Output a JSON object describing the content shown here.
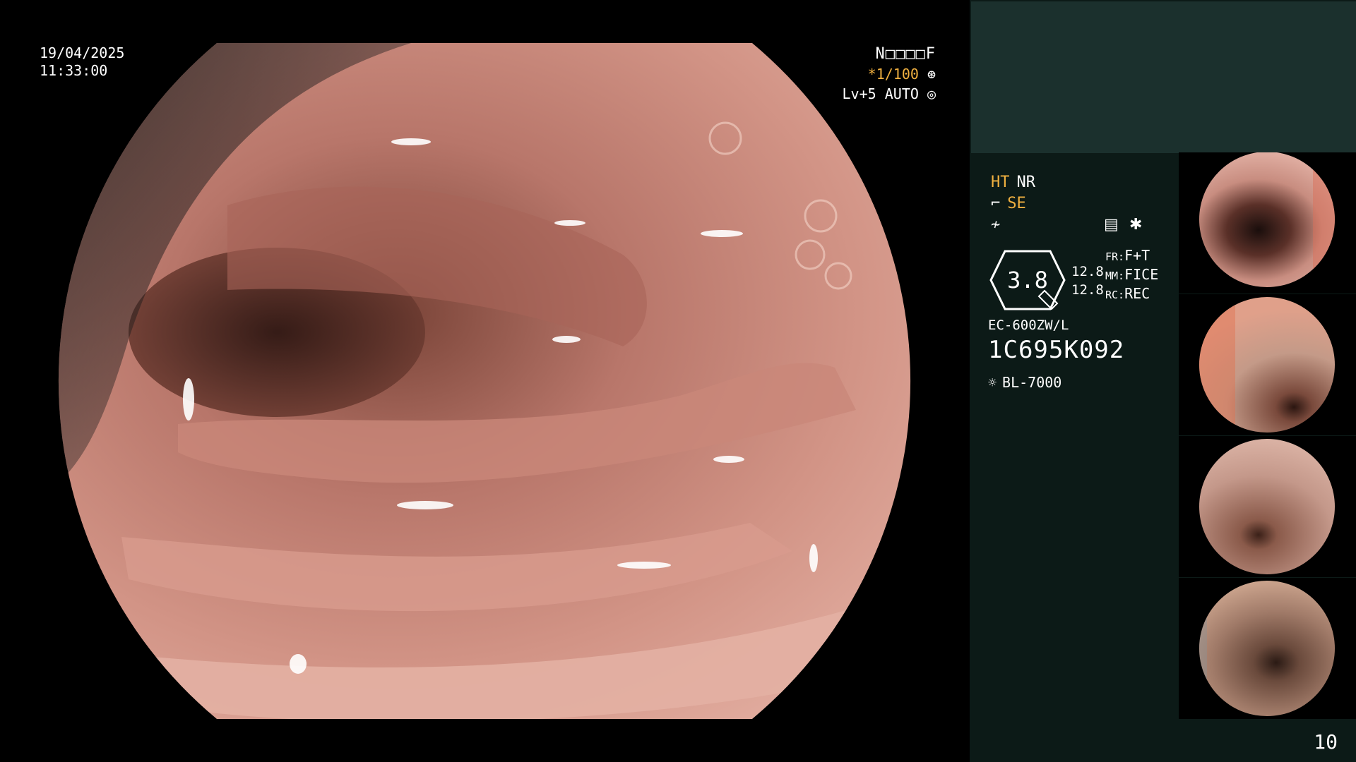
{
  "osd": {
    "date": "19/04/2025",
    "time": "11:33:00",
    "patient_id": "N□□□□F",
    "shutter": "*1/100",
    "level": "Lv+5",
    "iris_mode": "AUTO"
  },
  "panel": {
    "mode_ht": "HT",
    "mode_nr": "NR",
    "mode_se": "SE",
    "gauge_value": "3.8",
    "stat1": "12.8",
    "stat2": "12.8",
    "fr_label": "FR:",
    "fr_value": "F+T",
    "mm_label": "MM:",
    "mm_value": "FICE",
    "rc_label": "RC:",
    "rc_value": "REC",
    "scope_model": "EC-600ZW/L",
    "scope_serial": "1C695K092",
    "light_source": "BL-7000"
  },
  "page_number": "10",
  "thumbnails": [
    {
      "name": "thumbnail-1"
    },
    {
      "name": "thumbnail-2"
    },
    {
      "name": "thumbnail-3"
    },
    {
      "name": "thumbnail-4"
    }
  ]
}
